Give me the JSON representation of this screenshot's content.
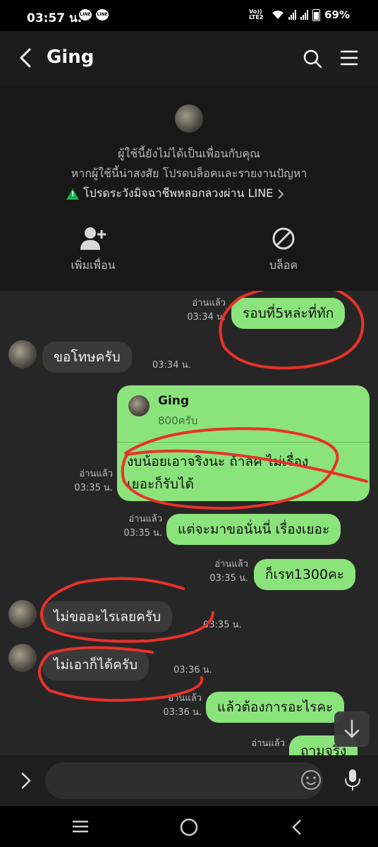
{
  "status_bar": {
    "time": "03:57 น.",
    "network": "Vo)) LTE2",
    "battery": "69%"
  },
  "header": {
    "title": "Ging"
  },
  "notice": {
    "line1": "ผู้ใช้นี้ยังไม่ได้เป็นเพื่อนกับคุณ",
    "line2": "หากผู้ใช้นี้น่าสงสัย โปรดบล็อคและรายงานปัญหา",
    "warning": "โปรดระวังมิจฉาชีพหลอกลวงผ่าน LINE",
    "add_friend_label": "เพิ่มเพื่อน",
    "block_label": "บล็อค"
  },
  "messages": [
    {
      "side": "out",
      "text": "รอบที่5หล่ะที่ทัก",
      "read": "อ่านแล้ว",
      "time": "03:34 น."
    },
    {
      "side": "in",
      "text": "ขอโทษครับ",
      "time": "03:34 น."
    },
    {
      "side": "out",
      "reply_name": "Ging",
      "reply_text": "800ครับ",
      "text": "งบน้อยเอาจริงนะ ถ้าลค ไม่เรื่อง\nเยอะก็รับได้",
      "read": "อ่านแล้ว",
      "time": "03:35 น."
    },
    {
      "side": "out",
      "text": "แต่จะมาขอนั่นนี่ เรื่องเยอะ",
      "read": "อ่านแล้ว",
      "time": "03:35 น."
    },
    {
      "side": "out",
      "text": "ก็เรท1300คะ",
      "read": "อ่านแล้ว",
      "time": "03:35 น."
    },
    {
      "side": "in",
      "text": "ไม่ขออะไรเลยครับ",
      "time": "03:35 น."
    },
    {
      "side": "in",
      "text": "ไม่เอาก็ได้ครับ",
      "time": "03:36 น."
    },
    {
      "side": "out",
      "text": "แล้วต้องการอะไรคะ",
      "read": "อ่านแล้ว",
      "time": "03:36 น."
    },
    {
      "side": "out",
      "text": "ถามจริง",
      "read": "อ่านแล้ว",
      "time": ""
    }
  ],
  "input": {
    "placeholder": ""
  },
  "colors": {
    "outgoing_bubble": "#8be37c",
    "incoming_bubble": "#3a3a3a",
    "warning_green": "#19b04b",
    "annotation_red": "#e8312a"
  }
}
